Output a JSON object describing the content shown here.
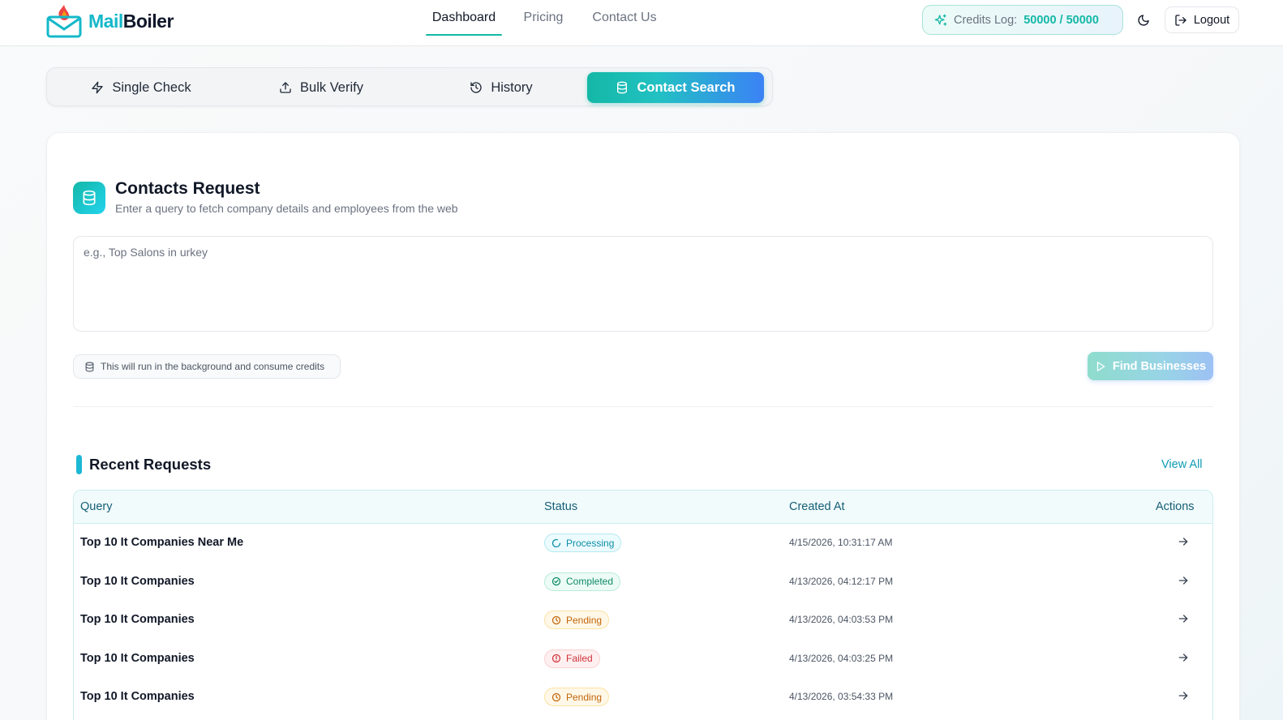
{
  "header": {
    "logo": {
      "part1": "Mail",
      "part2": "Boiler"
    },
    "nav": [
      {
        "label": "Dashboard",
        "active": true
      },
      {
        "label": "Pricing",
        "active": false
      },
      {
        "label": "Contact Us",
        "active": false
      }
    ],
    "credits": {
      "label": "Credits Log:",
      "value": "50000 / 50000"
    },
    "logout_label": "Logout"
  },
  "tabs": [
    {
      "label": "Single Check",
      "icon": "lightning-icon",
      "active": false
    },
    {
      "label": "Bulk Verify",
      "icon": "upload-icon",
      "active": false
    },
    {
      "label": "History",
      "icon": "history-icon",
      "active": false
    },
    {
      "label": "Contact Search",
      "icon": "database-icon",
      "active": true
    }
  ],
  "contacts_request": {
    "title": "Contacts Request",
    "subtitle": "Enter a query to fetch company details and employees from the web",
    "query_placeholder": "e.g., Top Salons in urkey",
    "query_value": "",
    "background_note": "This will run in the background and consume credits",
    "find_button": "Find Businesses"
  },
  "recent_requests": {
    "title": "Recent Requests",
    "view_all": "View All",
    "columns": [
      "Query",
      "Status",
      "Created At",
      "Actions"
    ],
    "rows": [
      {
        "query": "Top 10 It Companies Near Me",
        "status": "Processing",
        "status_type": "processing",
        "created_at": "4/15/2026, 10:31:17 AM"
      },
      {
        "query": "Top 10 It Companies",
        "status": "Completed",
        "status_type": "completed",
        "created_at": "4/13/2026, 04:12:17 PM"
      },
      {
        "query": "Top 10 It Companies",
        "status": "Pending",
        "status_type": "pending",
        "created_at": "4/13/2026, 04:03:53 PM"
      },
      {
        "query": "Top 10 It Companies",
        "status": "Failed",
        "status_type": "failed",
        "created_at": "4/13/2026, 04:03:25 PM"
      },
      {
        "query": "Top 10 It Companies",
        "status": "Pending",
        "status_type": "pending",
        "created_at": "4/13/2026, 03:54:33 PM"
      }
    ]
  },
  "colors": {
    "accent_teal": "#14b8a6",
    "accent_blue": "#3b82f6",
    "processing": "#0e8ea8",
    "completed": "#0f8a67",
    "pending": "#c2650a",
    "failed": "#d0313a"
  }
}
